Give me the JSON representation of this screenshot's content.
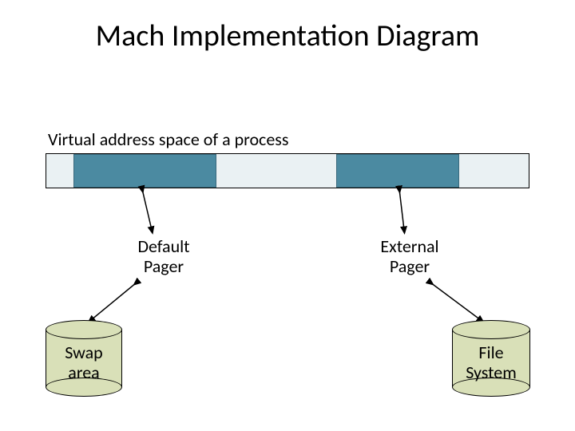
{
  "title": "Mach Implementation Diagram",
  "subtitle": "Virtual address space of a process",
  "pagers": {
    "default": {
      "line1": "Default",
      "line2": "Pager"
    },
    "external": {
      "line1": "External",
      "line2": "Pager"
    }
  },
  "stores": {
    "swap": {
      "line1": "Swap",
      "line2": "area"
    },
    "fs": {
      "line1": "File",
      "line2": "System"
    }
  },
  "colors": {
    "region_fill": "#4b8aa1",
    "strip_fill": "#eaf1f3",
    "cylinder_fill": "#d9e0b8"
  }
}
